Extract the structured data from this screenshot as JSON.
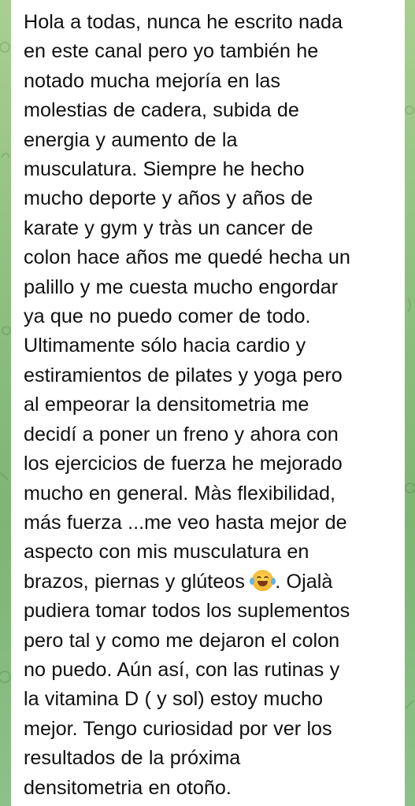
{
  "chat": {
    "message": {
      "emoji": "face-with-tears-of-joy",
      "lines": [
        "Hola a todas, nunca he escrito nada",
        "en este canal pero yo también he",
        "notado mucha mejoría en las",
        "molestias de cadera, subida de",
        "energia y aumento de la",
        "musculatura. Siempre he hecho",
        "mucho deporte y años y años de",
        "karate y gym y tràs un cancer de",
        "colon hace años me quedé hecha un",
        "palillo y me cuesta mucho engordar",
        "ya que no puedo comer de todo.",
        "Ultimamente sólo hacia cardio y",
        "estiramientos de pilates y yoga  pero",
        "al empeorar la densitometria me",
        "decidí a poner un freno y ahora con",
        "los ejercicios de fuerza he mejorado",
        "mucho en general. Màs flexibilidad,",
        "más fuerza ...me veo hasta mejor de",
        "aspecto con mis musculatura en",
        "pudiera tomar todos los suplementos",
        "pero tal y como me dejaron el colon",
        "no puedo. Aún así, con las rutinas y",
        "la vitamina D ( y sol) estoy mucho",
        "mejor. Tengo curiosidad por ver los",
        "resultados de la próxima",
        "densitometria en otoño."
      ],
      "emoji_line_before": "brazos, piernas y glúteos",
      "emoji_line_after": ". Ojalà"
    }
  }
}
